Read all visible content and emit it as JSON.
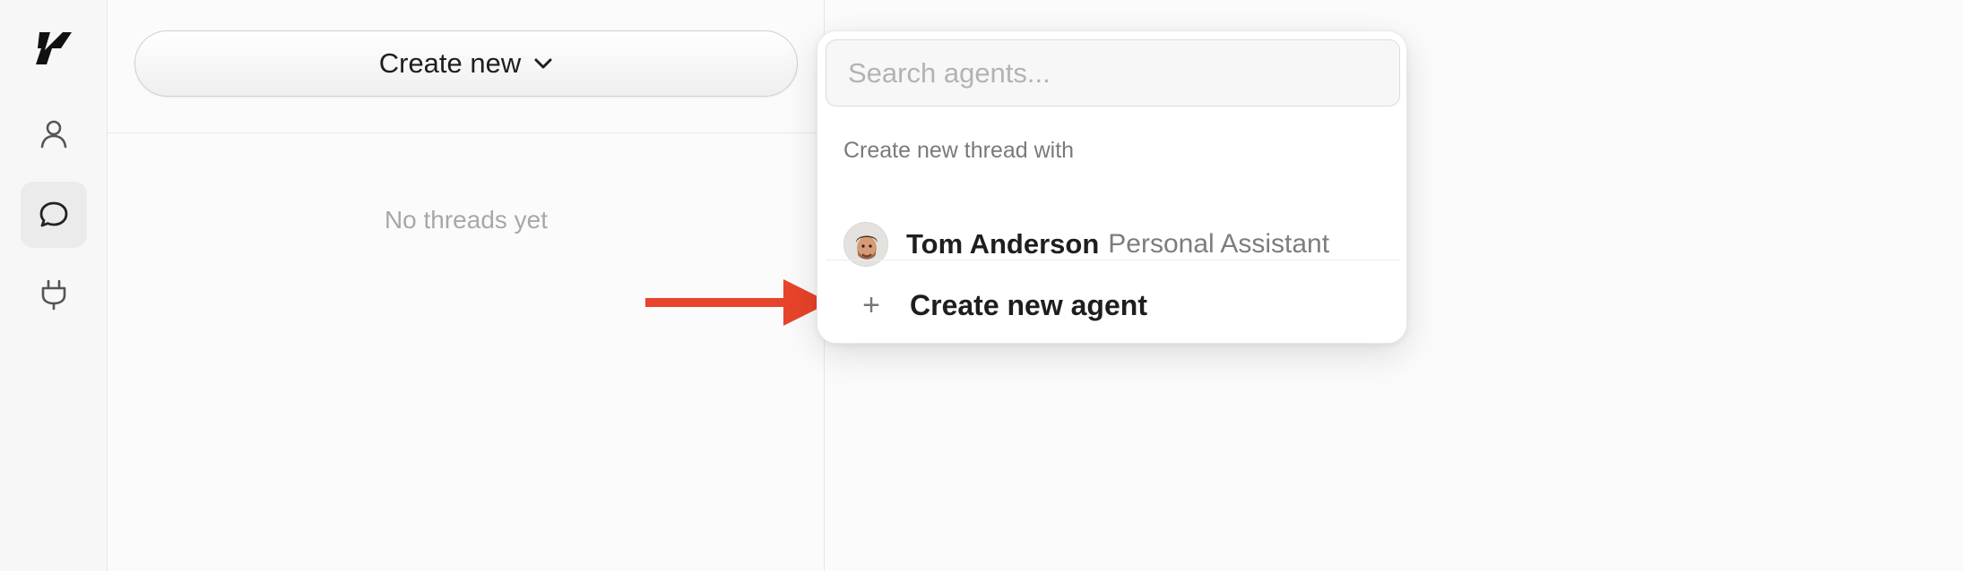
{
  "sidebar": {
    "items": [
      {
        "icon": "logo-icon"
      },
      {
        "icon": "person-icon"
      },
      {
        "icon": "chat-bubble-icon",
        "active": true
      },
      {
        "icon": "plug-icon"
      }
    ]
  },
  "threads": {
    "create_button_label": "Create new",
    "empty_text": "No threads yet"
  },
  "dropdown": {
    "search_placeholder": "Search agents...",
    "section_label": "Create new thread with",
    "agent": {
      "name": "Tom Anderson",
      "role": "Personal Assistant"
    },
    "create_agent_label": "Create new agent",
    "create_agent_icon": "+"
  },
  "colors": {
    "annotation_arrow": "#e8432b",
    "accent_text": "#1e1e1e"
  }
}
